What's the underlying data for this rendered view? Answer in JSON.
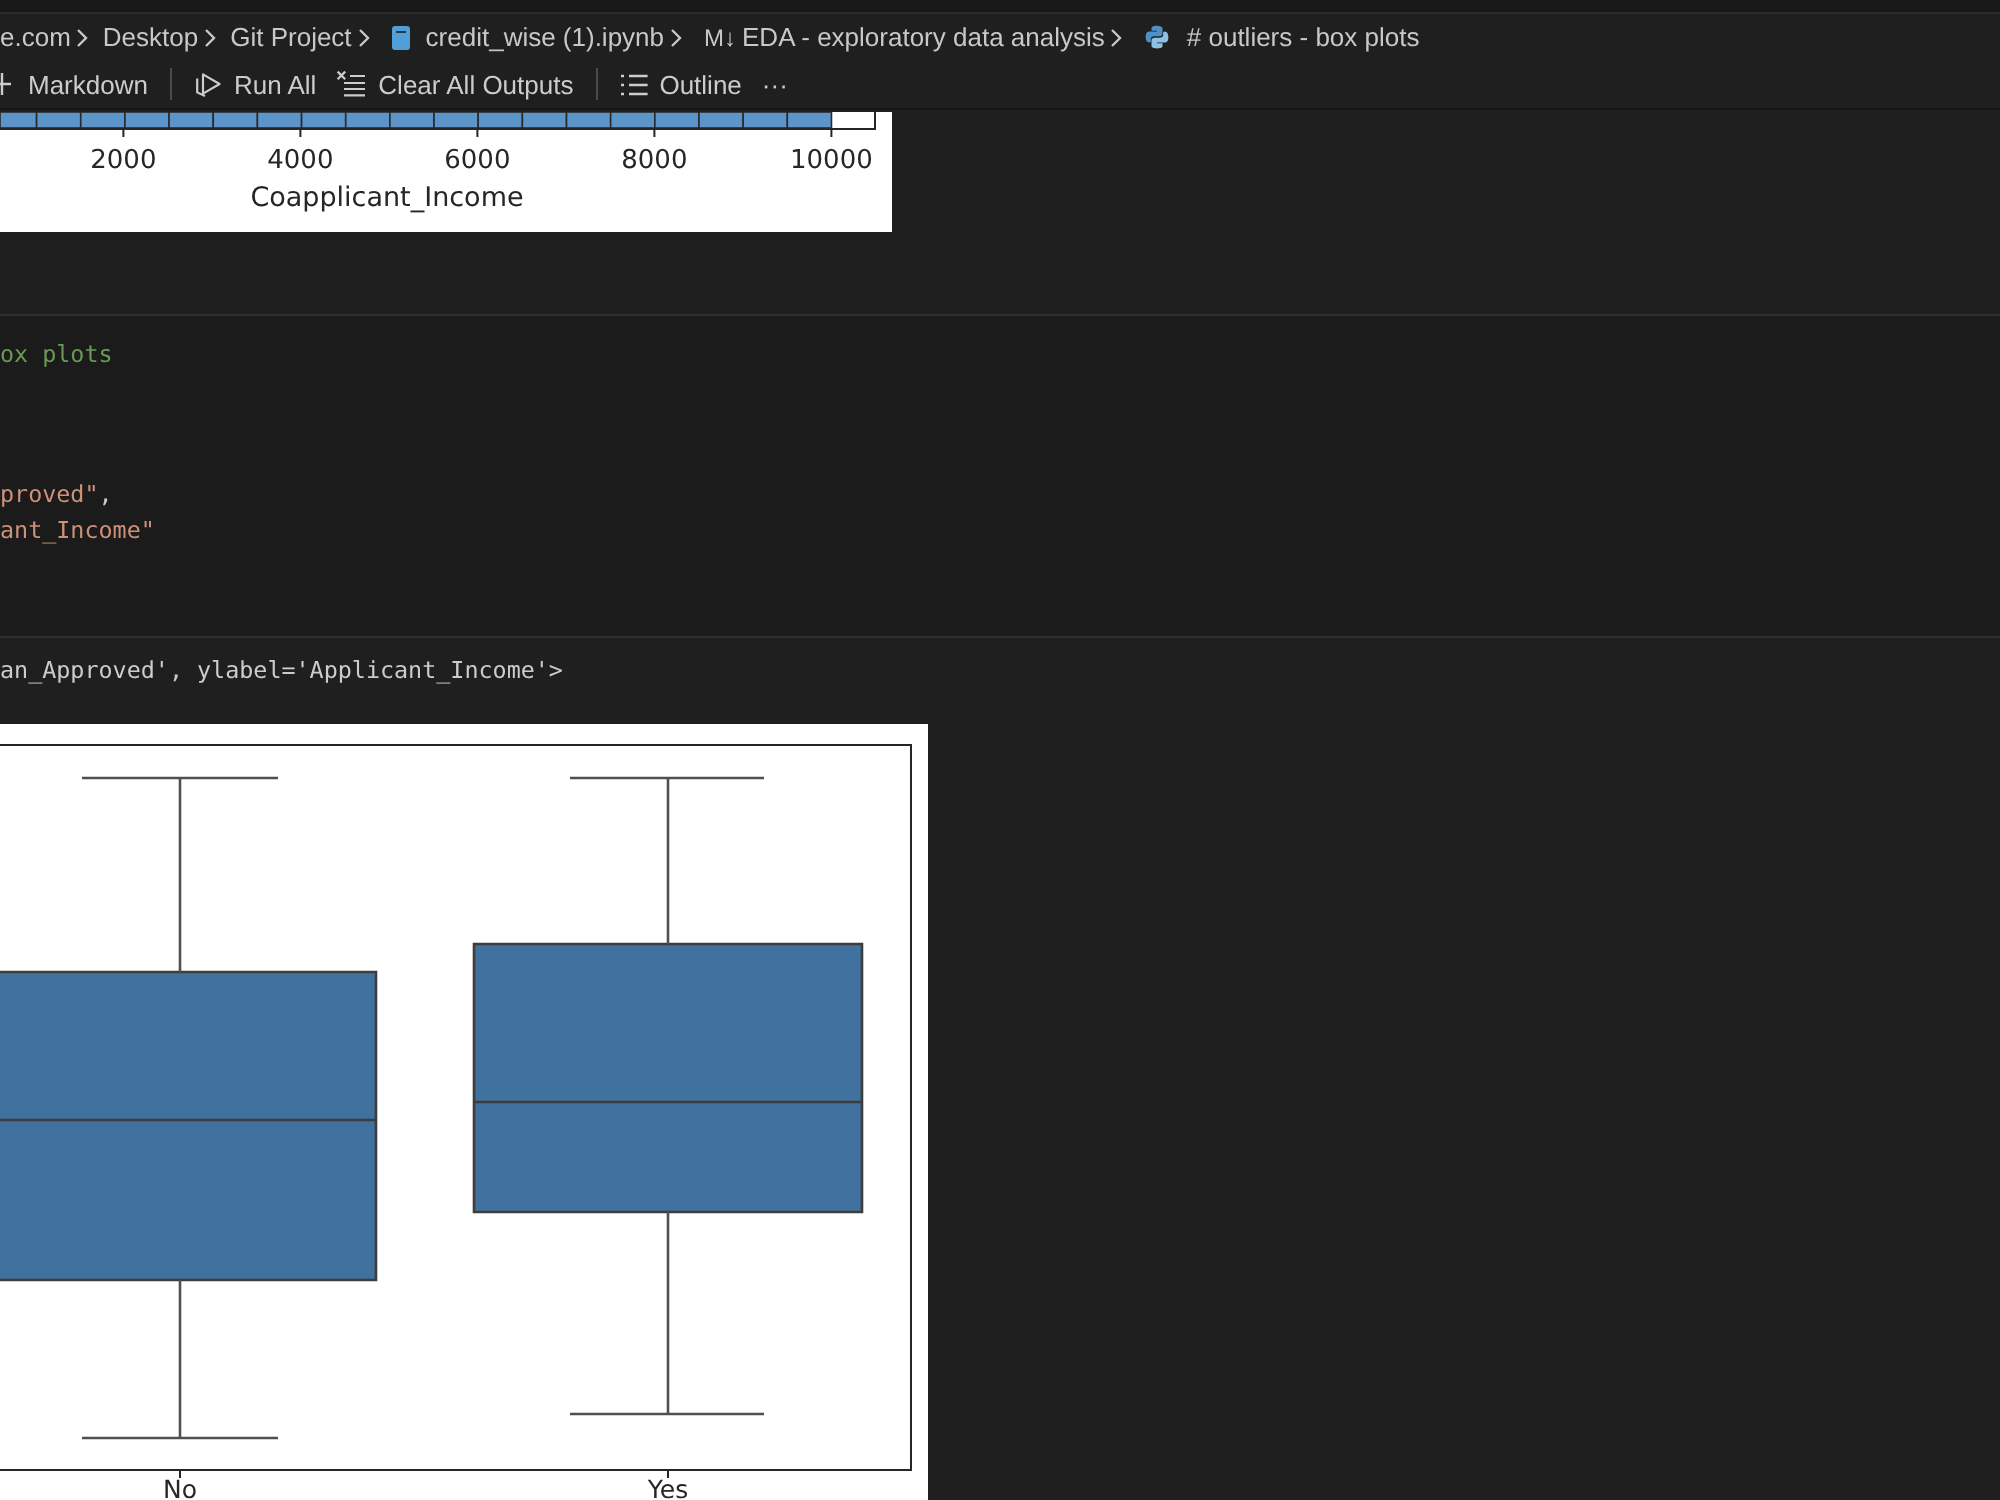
{
  "breadcrumbs": [
    {
      "kind": "text",
      "label": "e.com"
    },
    {
      "kind": "text",
      "label": "Desktop"
    },
    {
      "kind": "text",
      "label": "Git Project"
    },
    {
      "kind": "notebook",
      "label": "credit_wise (1).ipynb"
    },
    {
      "kind": "markdown",
      "glyph": "M↓",
      "label": "EDA - exploratory data analysis"
    },
    {
      "kind": "python",
      "label": "# outliers - box plots"
    }
  ],
  "toolbar": [
    {
      "kind": "add",
      "label": "Markdown"
    },
    {
      "kind": "separator"
    },
    {
      "kind": "run",
      "label": "Run All"
    },
    {
      "kind": "clear",
      "label": "Clear All Outputs"
    },
    {
      "kind": "separator"
    },
    {
      "kind": "outline",
      "label": "Outline"
    },
    {
      "kind": "more",
      "label": "···"
    }
  ],
  "histogram_output": {
    "tick_labels": [
      "2000",
      "4000",
      "6000",
      "8000",
      "10000"
    ],
    "xlabel": "Coapplicant_Income"
  },
  "code_cell": {
    "lines": [
      {
        "kind": "comment",
        "tokens": [
          {
            "kind": "comment",
            "text": "ox plots"
          }
        ]
      },
      {
        "kind": "code",
        "tokens": [
          {
            "kind": "string",
            "text": "proved\""
          },
          {
            "kind": "plain",
            "text": ","
          }
        ]
      },
      {
        "kind": "code",
        "tokens": [
          {
            "kind": "string",
            "text": "ant_Income\""
          }
        ]
      }
    ]
  },
  "output": {
    "text": "an_Approved', ylabel='Applicant_Income'>",
    "box_plot": {
      "categories": [
        "No",
        "Yes"
      ]
    }
  }
}
